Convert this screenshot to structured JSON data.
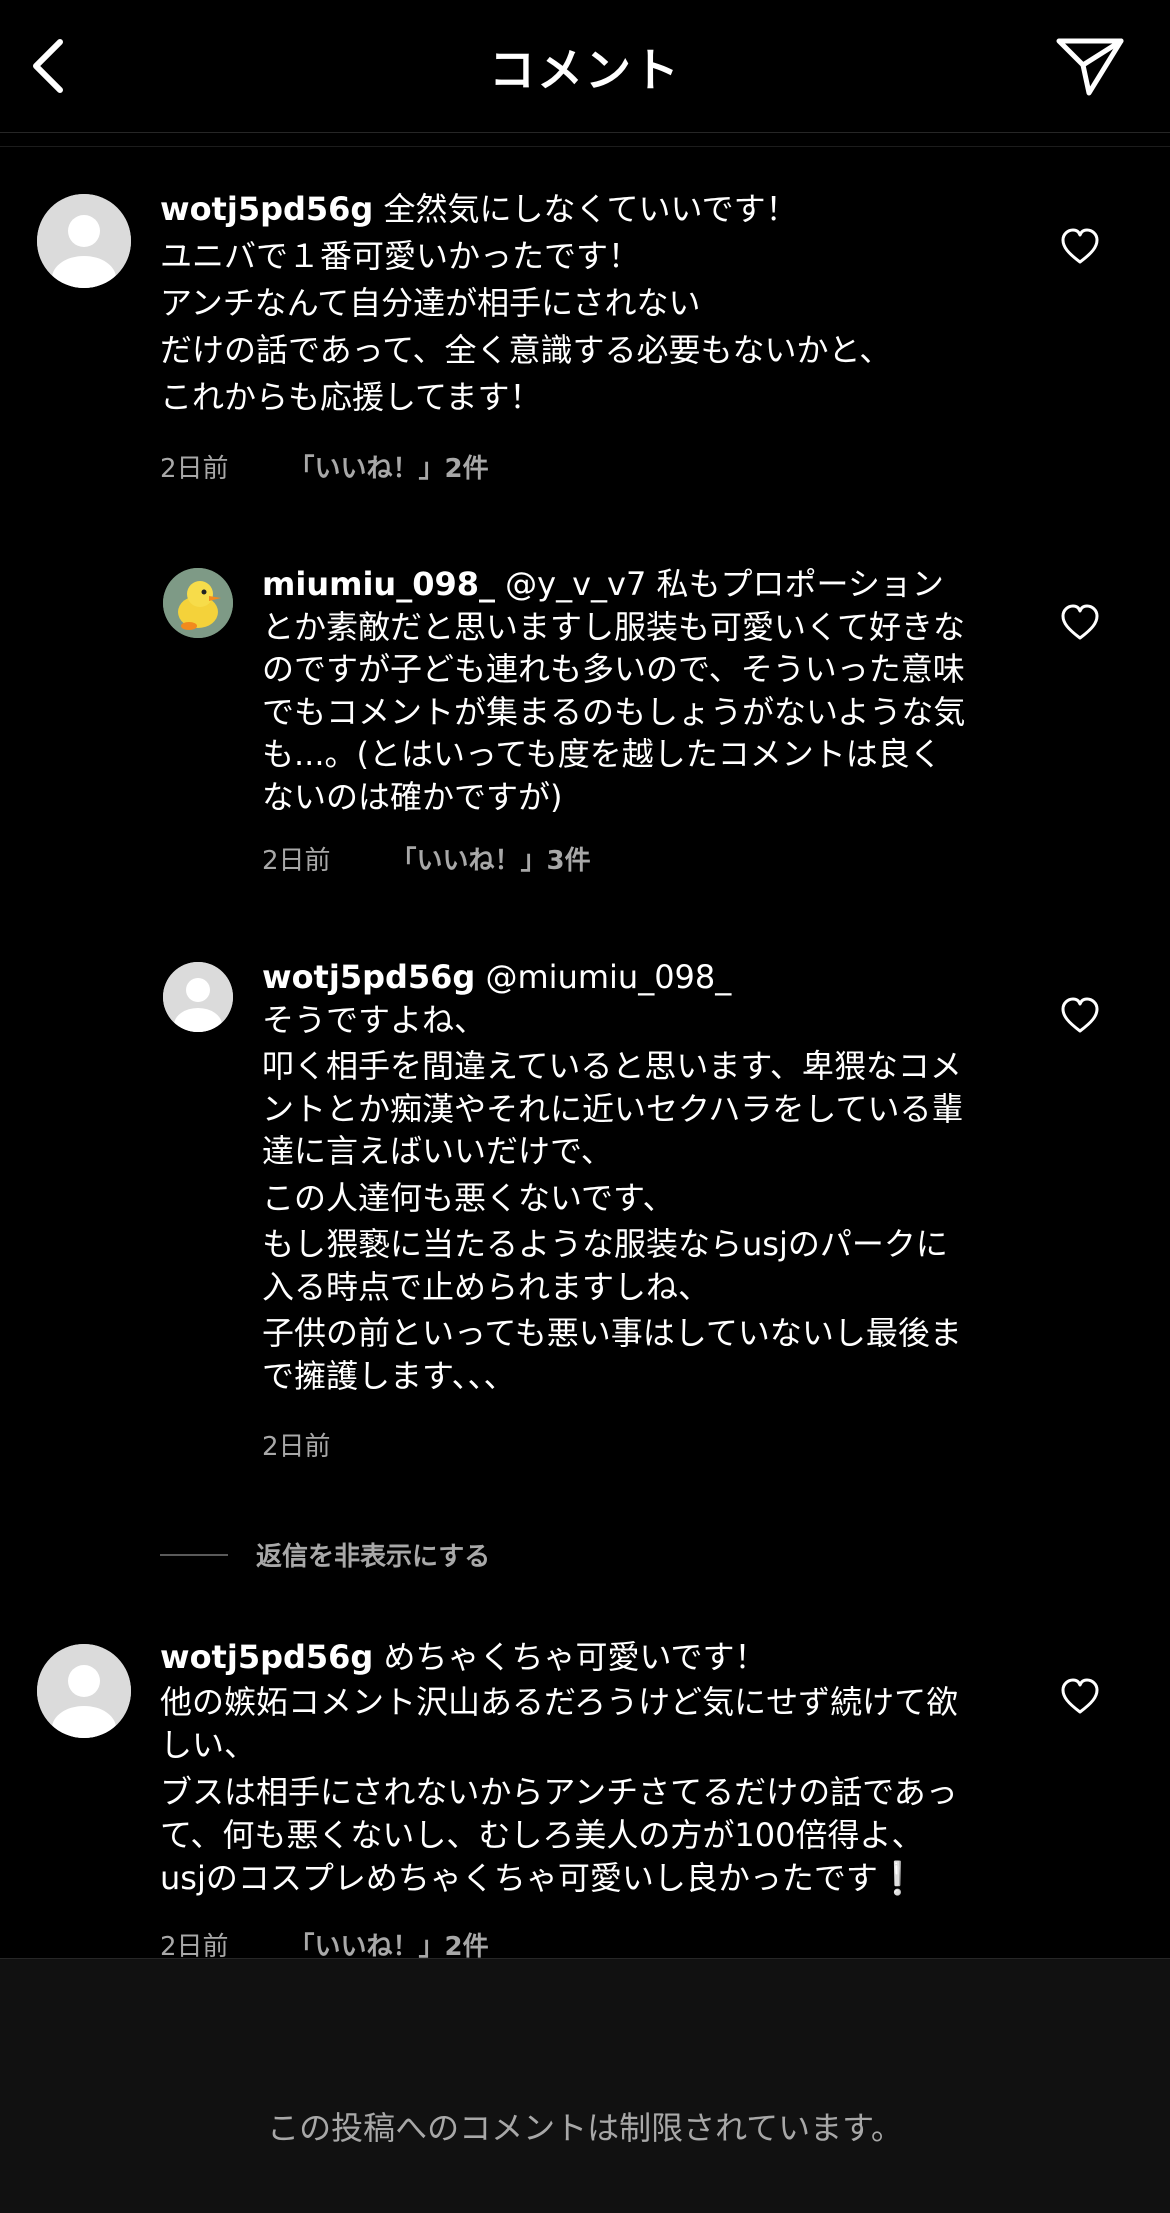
{
  "header": {
    "title": "コメント",
    "back_icon": "chevron-left-icon",
    "share_icon": "send-icon"
  },
  "comments": [
    {
      "username": "wotj5pd56g",
      "lines": [
        "全然気にしなくていいです！",
        "ユニバで１番可愛いかったです！",
        "アンチなんて自分達が相手にされない",
        "だけの話であって、全く意識する必要もないかと、",
        "これからも応援してます！"
      ],
      "time": "2日前",
      "likes": "「いいね！」2件"
    },
    {
      "username": "miumiu_098_",
      "lines": [
        "@y_v_v7 私もプロポーション",
        "とか素敵だと思いますし服装も可愛いくて好きな",
        "のですが子ども連れも多いので、そういった意味",
        "でもコメントが集まるのもしょうがないような気",
        "も...。(とはいっても度を越したコメントは良く",
        "ないのは確かですが)"
      ],
      "time": "2日前",
      "likes": "「いいね！」3件"
    },
    {
      "username": "wotj5pd56g",
      "lines": [
        "@miumiu_098_",
        "そうですよね、",
        "叩く相手を間違えていると思います、卑猥なコメ",
        "ントとか痴漢やそれに近いセクハラをしている輩",
        "達に言えばいいだけで、",
        "この人達何も悪くないです、",
        "もし猥褻に当たるような服装ならusjのパークに",
        "入る時点で止められますしね、",
        "子供の前といっても悪い事はしていないし最後ま",
        "で擁護します、、、"
      ],
      "time": "2日前"
    },
    {
      "username": "wotj5pd56g",
      "lines": [
        "めちゃくちゃ可愛いです！",
        "他の嫉妬コメント沢山あるだろうけど気にせず続けて欲",
        "しい、",
        "ブスは相手にされないからアンチさてるだけの話であっ",
        "て、何も悪くないし、むしろ美人の方が100倍得よ、",
        "usjのコスプレめちゃくちゃ可愛いし良かったです❕"
      ],
      "time": "2日前",
      "likes": "「いいね！」2件"
    }
  ],
  "hide_replies_label": "返信を非表示にする",
  "footer_text": "この投稿へのコメントは制限されています。",
  "colors": {
    "background": "#000000",
    "secondary_text": "#a8a8a8",
    "avatar_placeholder": "#dbdbdb"
  }
}
